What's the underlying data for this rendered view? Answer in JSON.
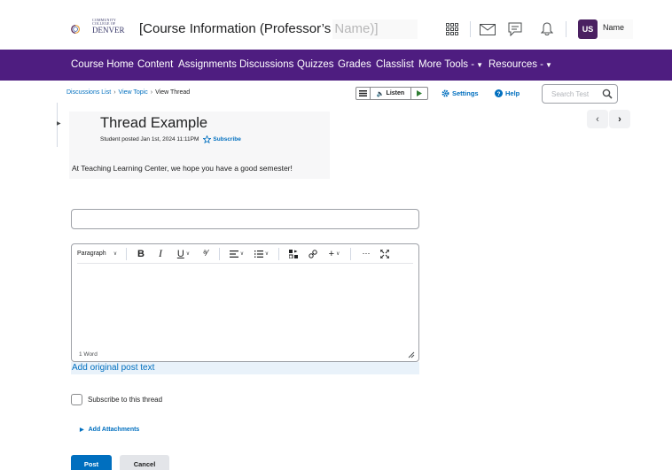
{
  "header": {
    "logo_line1": "COMMUNITY",
    "logo_line2": "COLLEGE OF",
    "logo_line3": "DENVER",
    "course_title": "[Course Information (Professor’s Name)]",
    "icons": [
      "grid-icon",
      "mail-icon",
      "chat-icon",
      "bell-icon"
    ],
    "user_initials": "US",
    "user_name": "Name"
  },
  "nav": {
    "items": [
      {
        "label": "Course Home"
      },
      {
        "label": "Content"
      },
      {
        "label": "Assignments"
      },
      {
        "label": "Discussions"
      },
      {
        "label": "Quizzes"
      },
      {
        "label": "Grades"
      },
      {
        "label": "Classlist"
      },
      {
        "label": "More Tools -",
        "dropdown": true
      },
      {
        "label": "Resources -",
        "dropdown": true
      }
    ],
    "bg_color": "#4e1d80"
  },
  "breadcrumb": {
    "items": [
      "Discussions List",
      "View Topic",
      "View Thread"
    ]
  },
  "toolbar": {
    "listen_label": "Listen",
    "settings_label": "Settings",
    "help_label": "Help",
    "search_placeholder": "Search Test"
  },
  "thread": {
    "title": "Thread Example",
    "meta": "Student posted Jan 1st, 2024  11:11PM",
    "subscribe_label": "Subscribe",
    "body": "At Teaching Learning Center, we hope you have a good semester!"
  },
  "reply": {
    "subject_value": "",
    "editor_format": "Paragraph",
    "word_count": "1 Word",
    "hint": "Add original post text",
    "subscribe_label": "Subscribe to this thread",
    "attachments_label": "Add Attachments",
    "post_label": "Post",
    "cancel_label": "Cancel"
  },
  "colors": {
    "accent": "#006fbf",
    "brand_purple": "#4e1d80"
  }
}
